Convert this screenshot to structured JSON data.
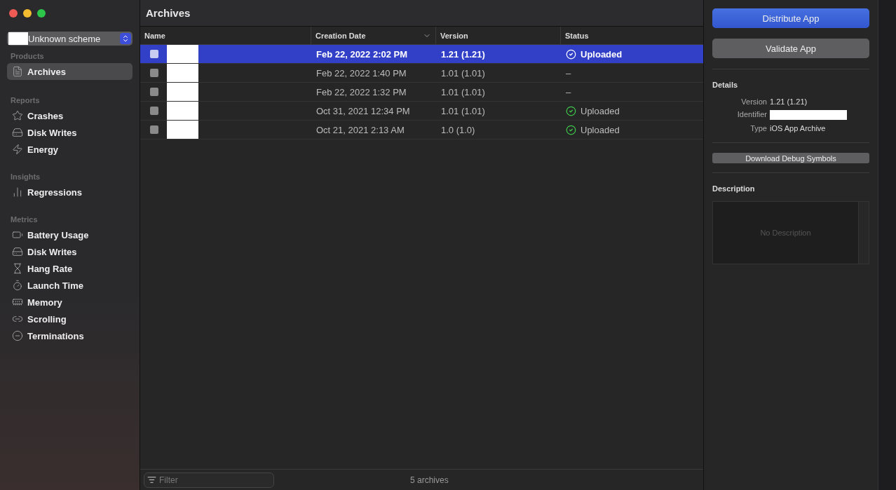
{
  "window": {
    "title": "Archives"
  },
  "scheme": {
    "label": "Unknown scheme"
  },
  "sidebar": {
    "sections": [
      {
        "title": "Products",
        "items": [
          {
            "label": "Archives",
            "selected": true
          }
        ]
      },
      {
        "title": "Reports",
        "items": [
          {
            "label": "Crashes",
            "selected": false
          },
          {
            "label": "Disk Writes",
            "selected": false
          },
          {
            "label": "Energy",
            "selected": false
          }
        ]
      },
      {
        "title": "Insights",
        "items": [
          {
            "label": "Regressions",
            "selected": false
          }
        ]
      },
      {
        "title": "Metrics",
        "items": [
          {
            "label": "Battery Usage",
            "selected": false
          },
          {
            "label": "Disk Writes",
            "selected": false
          },
          {
            "label": "Hang Rate",
            "selected": false
          },
          {
            "label": "Launch Time",
            "selected": false
          },
          {
            "label": "Memory",
            "selected": false
          },
          {
            "label": "Scrolling",
            "selected": false
          },
          {
            "label": "Terminations",
            "selected": false
          }
        ]
      }
    ]
  },
  "table": {
    "columns": [
      "Name",
      "Creation Date",
      "Version",
      "Status"
    ],
    "rows": [
      {
        "date": "Feb 22, 2022 2:02 PM",
        "version": "1.21 (1.21)",
        "status": "Uploaded",
        "kind": "uploaded",
        "selected": true
      },
      {
        "date": "Feb 22, 2022 1:40 PM",
        "version": "1.01 (1.01)",
        "status": "–",
        "kind": "none",
        "selected": false
      },
      {
        "date": "Feb 22, 2022 1:32 PM",
        "version": "1.01 (1.01)",
        "status": "–",
        "kind": "none",
        "selected": false
      },
      {
        "date": "Oct 31, 2021 12:34 PM",
        "version": "1.01 (1.01)",
        "status": "Uploaded",
        "kind": "uploaded",
        "selected": false
      },
      {
        "date": "Oct 21, 2021 2:13 AM",
        "version": "1.0 (1.0)",
        "status": "Uploaded",
        "kind": "uploaded",
        "selected": false
      }
    ]
  },
  "filter": {
    "placeholder": "Filter"
  },
  "status_bar": "5 archives",
  "inspector": {
    "buttons": [
      "Distribute App",
      "Validate App"
    ],
    "details_title": "Details",
    "details": [
      {
        "label": "Version",
        "value": "1.21 (1.21)"
      },
      {
        "label": "Identifier"
      },
      {
        "label": "Type",
        "value": "iOS App Archive"
      }
    ],
    "debug_button": "Download Debug Symbols",
    "description_title": "Description",
    "description_placeholder": "No Description"
  }
}
